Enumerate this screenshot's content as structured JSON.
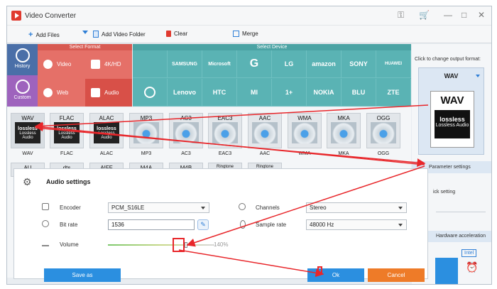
{
  "window": {
    "title": "Video Converter",
    "controls": [
      "⚿",
      "🛒",
      "—",
      "□",
      "✕"
    ]
  },
  "toolbar": {
    "add_files": "Add Files",
    "add_video_folder": "Add Video Folder",
    "clear": "Clear",
    "merge": "Merge"
  },
  "nav": {
    "history": "History",
    "custom": "Custom"
  },
  "sections": {
    "select_format": "Select Format",
    "select_device": "Select Device"
  },
  "format_buttons": [
    {
      "label": "Video",
      "icon": "play-icon"
    },
    {
      "label": "4K/HD",
      "icon": "4k-icon"
    },
    {
      "label": "Web",
      "icon": "chrome-icon"
    },
    {
      "label": "Audio",
      "icon": "speaker-icon"
    }
  ],
  "devices_row1": [
    "",
    "SAMSUNG",
    "Microsoft",
    "G",
    "LG",
    "amazon",
    "SONY",
    "HUAWEI",
    "honor",
    "ASUS"
  ],
  "devices_row2": [
    "",
    "Lenovo",
    "HTC",
    "MI",
    "1+",
    "NOKIA",
    "BLU",
    "ZTE",
    "alcatel",
    "TV"
  ],
  "format_cards_row1": [
    {
      "label": "WAV",
      "name": "WAV",
      "style": "lossless"
    },
    {
      "label": "FLAC",
      "name": "FLAC",
      "style": "lossless"
    },
    {
      "label": "ALAC",
      "name": "ALAC",
      "style": "lossless"
    },
    {
      "label": "MP3",
      "name": "MP3",
      "style": "disc"
    },
    {
      "label": "AC3",
      "name": "AC3",
      "style": "disc"
    },
    {
      "label": "EAC3",
      "name": "EAC3",
      "style": "disc"
    },
    {
      "label": "AAC",
      "name": "AAC",
      "style": "disc"
    },
    {
      "label": "WMA",
      "name": "WMA",
      "style": "disc"
    },
    {
      "label": "MKA",
      "name": "MKA",
      "style": "disc"
    },
    {
      "label": "OGG",
      "name": "OGG",
      "style": "disc"
    }
  ],
  "format_cards_row2": [
    "AU",
    "dts",
    "AIFF",
    "M4A",
    "M4B",
    "Ringtone",
    "Ringtone"
  ],
  "lossless_text": {
    "brand": "lossless",
    "sub": "Lossless Audio"
  },
  "right_panel": {
    "hint": "Click to change output format:",
    "output_format": "WAV",
    "parameter_settings": "Parameter settings",
    "quick_setting": "ick setting",
    "hardware_acceleration": "Hardware acceleration",
    "intel": "Intel"
  },
  "dialog": {
    "title": "Audio settings",
    "encoder_label": "Encoder",
    "encoder_value": "PCM_S16LE",
    "bitrate_label": "Bit rate",
    "bitrate_value": "1536",
    "volume_label": "Volume",
    "volume_percent": "140%",
    "volume_level": 0.73,
    "channels_label": "Channels",
    "channels_value": "Stereo",
    "samplerate_label": "Sample rate",
    "samplerate_value": "48000 Hz",
    "save_as": "Save as",
    "ok": "Ok",
    "cancel": "Cancel"
  },
  "colors": {
    "accent_blue": "#2b8fe0",
    "orange": "#ee7b28",
    "annotation_red": "#e8262a",
    "format_red": "#e57068",
    "device_teal": "#5ab3b4"
  }
}
